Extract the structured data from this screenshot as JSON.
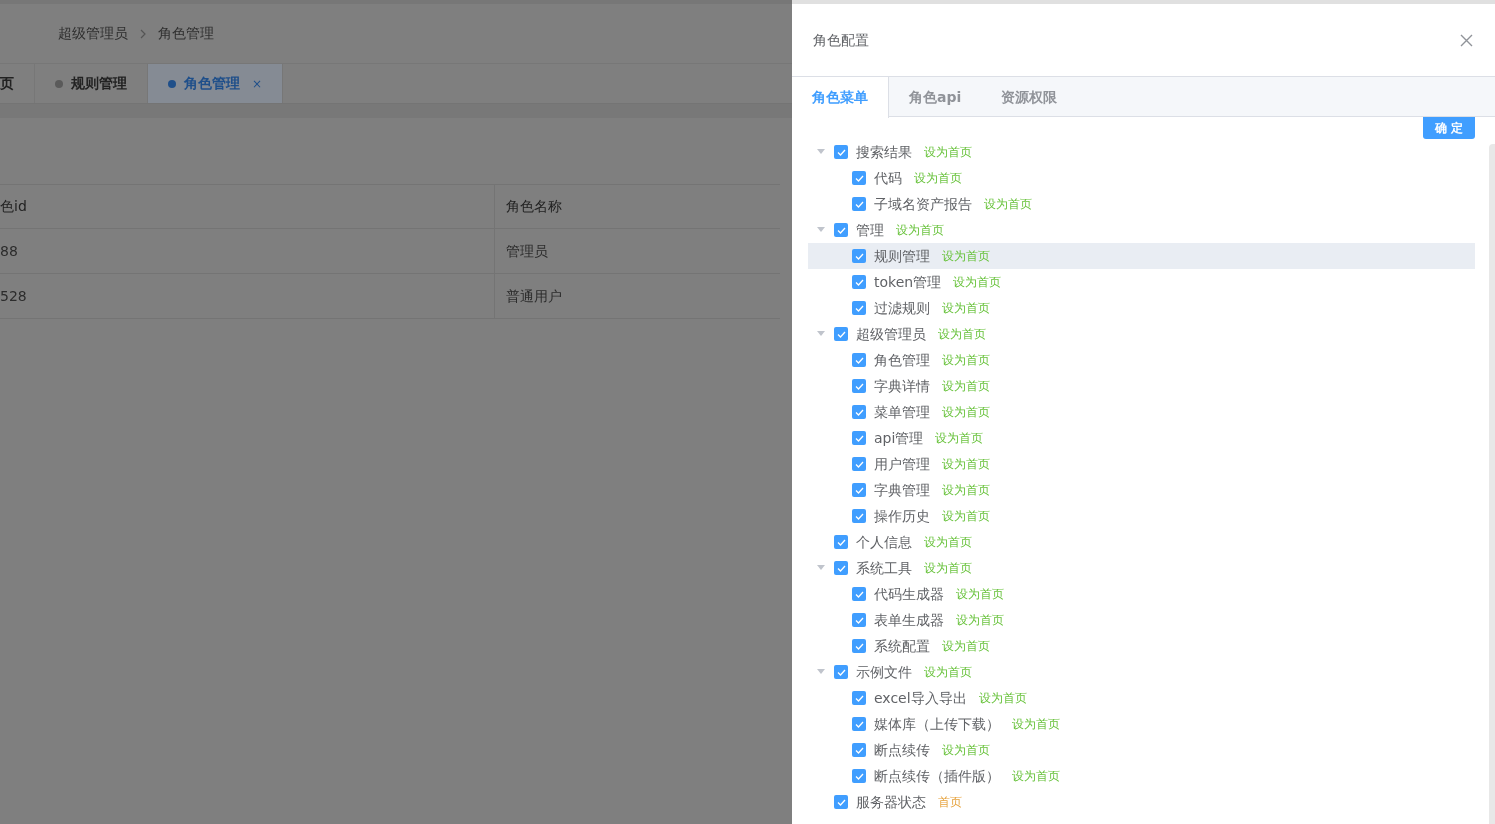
{
  "breadcrumb": [
    "超级管理员",
    "角色管理"
  ],
  "page_tabs": [
    {
      "label": "页",
      "selected": false,
      "dot": false,
      "closable": false
    },
    {
      "label": "规则管理",
      "selected": false,
      "dot": true,
      "closable": false
    },
    {
      "label": "角色管理",
      "selected": true,
      "dot": true,
      "closable": true,
      "close": "×"
    }
  ],
  "table": {
    "columns": [
      "色id",
      "角色名称"
    ],
    "rows": [
      [
        "88",
        "管理员"
      ],
      [
        "528",
        "普通用户"
      ]
    ]
  },
  "drawer": {
    "title": "角色配置",
    "tabs": [
      {
        "label": "角色菜单",
        "selected": true
      },
      {
        "label": "角色api",
        "selected": false
      },
      {
        "label": "资源权限",
        "selected": false
      }
    ],
    "confirm": "确 定",
    "tree": [
      {
        "label": "搜索结果",
        "checked": true,
        "expanded": true,
        "highlighted": false,
        "home": false,
        "action": "设为首页",
        "children": [
          {
            "label": "代码",
            "checked": true,
            "highlighted": false,
            "home": false,
            "action": "设为首页"
          },
          {
            "label": "子域名资产报告",
            "checked": true,
            "highlighted": false,
            "home": false,
            "action": "设为首页"
          }
        ]
      },
      {
        "label": "管理",
        "checked": true,
        "expanded": true,
        "highlighted": false,
        "home": false,
        "action": "设为首页",
        "children": [
          {
            "label": "规则管理",
            "checked": true,
            "highlighted": true,
            "home": false,
            "action": "设为首页"
          },
          {
            "label": "token管理",
            "checked": true,
            "highlighted": false,
            "home": false,
            "action": "设为首页"
          },
          {
            "label": "过滤规则",
            "checked": true,
            "highlighted": false,
            "home": false,
            "action": "设为首页"
          }
        ]
      },
      {
        "label": "超级管理员",
        "checked": true,
        "expanded": true,
        "highlighted": false,
        "home": false,
        "action": "设为首页",
        "children": [
          {
            "label": "角色管理",
            "checked": true,
            "highlighted": false,
            "home": false,
            "action": "设为首页"
          },
          {
            "label": "字典详情",
            "checked": true,
            "highlighted": false,
            "home": false,
            "action": "设为首页"
          },
          {
            "label": "菜单管理",
            "checked": true,
            "highlighted": false,
            "home": false,
            "action": "设为首页"
          },
          {
            "label": "api管理",
            "checked": true,
            "highlighted": false,
            "home": false,
            "action": "设为首页"
          },
          {
            "label": "用户管理",
            "checked": true,
            "highlighted": false,
            "home": false,
            "action": "设为首页"
          },
          {
            "label": "字典管理",
            "checked": true,
            "highlighted": false,
            "home": false,
            "action": "设为首页"
          },
          {
            "label": "操作历史",
            "checked": true,
            "highlighted": false,
            "home": false,
            "action": "设为首页"
          }
        ]
      },
      {
        "label": "个人信息",
        "checked": true,
        "highlighted": false,
        "home": false,
        "action": "设为首页"
      },
      {
        "label": "系统工具",
        "checked": true,
        "expanded": true,
        "highlighted": false,
        "home": false,
        "action": "设为首页",
        "children": [
          {
            "label": "代码生成器",
            "checked": true,
            "highlighted": false,
            "home": false,
            "action": "设为首页"
          },
          {
            "label": "表单生成器",
            "checked": true,
            "highlighted": false,
            "home": false,
            "action": "设为首页"
          },
          {
            "label": "系统配置",
            "checked": true,
            "highlighted": false,
            "home": false,
            "action": "设为首页"
          }
        ]
      },
      {
        "label": "示例文件",
        "checked": true,
        "expanded": true,
        "highlighted": false,
        "home": false,
        "action": "设为首页",
        "children": [
          {
            "label": "excel导入导出",
            "checked": true,
            "highlighted": false,
            "home": false,
            "action": "设为首页"
          },
          {
            "label": "媒体库（上传下载）",
            "checked": true,
            "highlighted": false,
            "home": false,
            "action": "设为首页"
          },
          {
            "label": "断点续传",
            "checked": true,
            "highlighted": false,
            "home": false,
            "action": "设为首页"
          },
          {
            "label": "断点续传（插件版）",
            "checked": true,
            "highlighted": false,
            "home": false,
            "action": "设为首页"
          }
        ]
      },
      {
        "label": "服务器状态",
        "checked": true,
        "highlighted": false,
        "home": true,
        "action": "首页"
      }
    ]
  }
}
